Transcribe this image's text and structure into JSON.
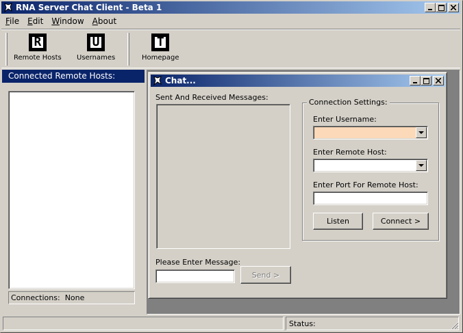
{
  "app": {
    "title": "RNA Server Chat Client - Beta 1"
  },
  "menu": {
    "items": [
      {
        "label": "File",
        "underline": "F",
        "rest": "ile"
      },
      {
        "label": "Edit",
        "underline": "E",
        "rest": "dit"
      },
      {
        "label": "Window",
        "underline": "W",
        "rest": "indow"
      },
      {
        "label": "About",
        "underline": "A",
        "rest": "bout"
      }
    ]
  },
  "toolbar": {
    "buttons": [
      {
        "glyph": "R",
        "label": "Remote Hosts",
        "icon": "remote-hosts-icon"
      },
      {
        "glyph": "U",
        "label": "Usernames",
        "icon": "usernames-icon"
      },
      {
        "glyph": "T",
        "label": "Homepage",
        "icon": "homepage-icon"
      }
    ]
  },
  "left_panel": {
    "header": "Connected Remote Hosts:",
    "connections_label": "Connections:",
    "connections_value": "None"
  },
  "chat": {
    "title": "Chat...",
    "messages_label": "Sent And Received Messages:",
    "message_prompt": "Please Enter Message:",
    "message_value": "",
    "send_label": "Send >",
    "connection_settings": {
      "legend": "Connection Settings:",
      "username_label": "Enter Username:",
      "username_value": "",
      "remote_host_label": "Enter Remote Host:",
      "remote_host_value": "",
      "port_label": "Enter Port For Remote Host:",
      "port_value": "",
      "listen_label": "Listen",
      "connect_label": "Connect >"
    }
  },
  "statusbar": {
    "left_text": "",
    "status_label": "Status:"
  },
  "colors": {
    "titlebar_start": "#0a246a",
    "titlebar_end": "#a6caf0",
    "username_field_bg": "#fcd9b8",
    "workspace": "#808080"
  }
}
